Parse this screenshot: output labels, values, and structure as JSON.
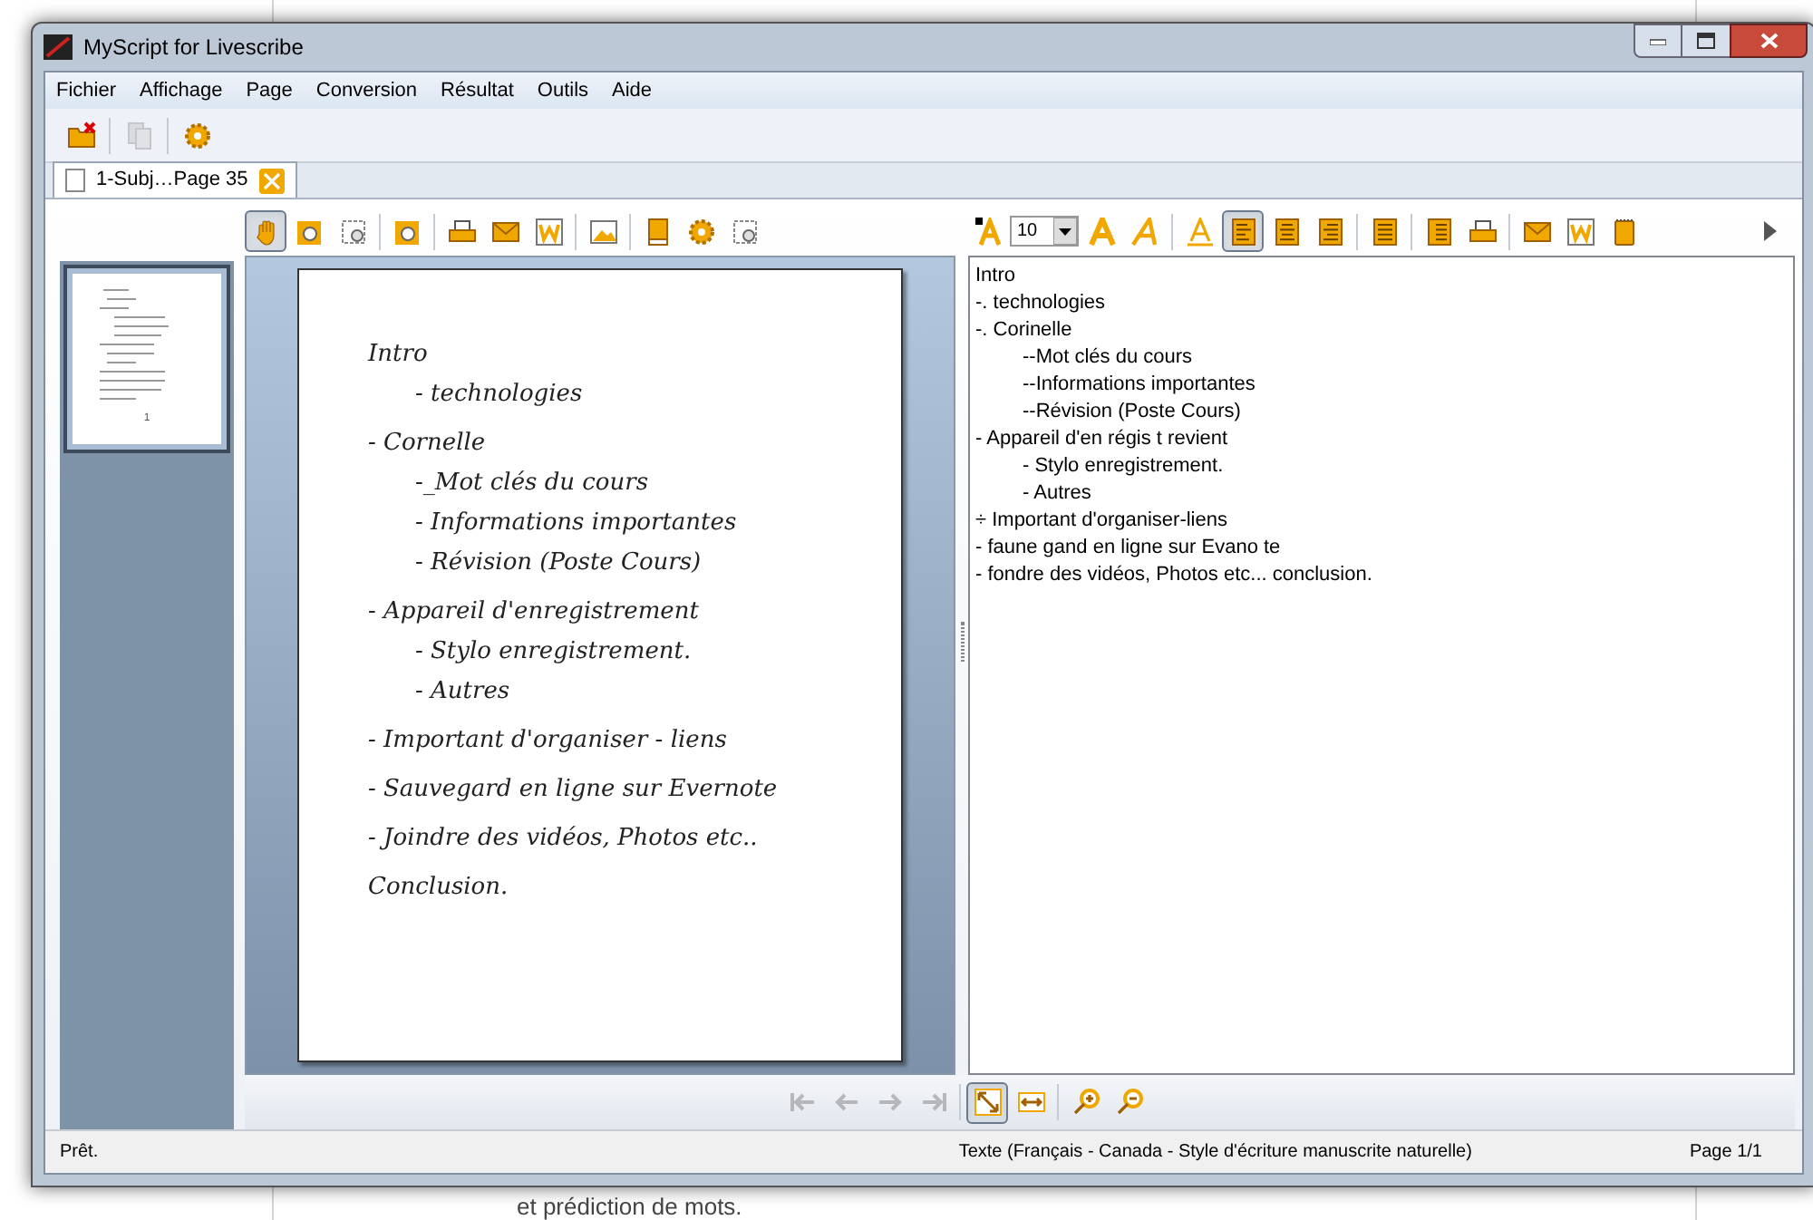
{
  "background": {
    "text": "et prédiction de mots."
  },
  "window": {
    "title": "MyScript for Livescribe"
  },
  "menu": [
    "Fichier",
    "Affichage",
    "Page",
    "Conversion",
    "Résultat",
    "Outils",
    "Aide"
  ],
  "main_toolbar": [
    {
      "disabled": false
    },
    {
      "disabled": true
    },
    {
      "disabled": false
    }
  ],
  "tabs": [
    {
      "label": "1-Subj…Page 35",
      "selected": true
    }
  ],
  "thumbnail": {
    "label": "1",
    "selected": true
  },
  "ink_toolbar": [
    {
      "selected": true
    },
    {
      "selected": false
    },
    {
      "selected": false
    },
    {
      "selected": false
    },
    {
      "selected": false
    },
    {
      "selected": false
    },
    {
      "selected": false
    },
    {
      "selected": false
    },
    {
      "selected": false
    },
    {
      "selected": false
    },
    {
      "selected": false
    }
  ],
  "handwriting": [
    {
      "text": "Intro",
      "children": [
        {
          "text": "- technologies"
        }
      ]
    },
    {
      "text": "- Cornelle",
      "children": [
        {
          "text": "-_Mot clés du cours"
        },
        {
          "text": "- Informations importantes"
        },
        {
          "text": "- Révision (Poste Cours)"
        }
      ]
    },
    {
      "text": "- Appareil d'enregistrement",
      "children": [
        {
          "text": "- Stylo enregistrement."
        },
        {
          "text": "- Autres"
        }
      ]
    },
    {
      "text": "- Important d'organiser - liens"
    },
    {
      "text": "- Sauvegard en ligne sur Evernote"
    },
    {
      "text": "- Joindre des vidéos, Photos etc.."
    },
    {
      "text": "Conclusion."
    }
  ],
  "text_toolbar": {
    "font_size": "10",
    "buttons": [
      {
        "selected": false
      },
      {
        "selected": false
      },
      {
        "selected": false
      },
      {
        "selected": true
      },
      {
        "selected": false
      },
      {
        "selected": false
      },
      {
        "selected": false
      },
      {
        "selected": false
      },
      {
        "selected": false
      },
      {
        "selected": false
      },
      {
        "selected": false
      }
    ]
  },
  "result_text": [
    {
      "text": "Intro"
    },
    {
      "text": "-. technologies"
    },
    {
      "text": "-. Corinelle",
      "children": [
        {
          "text": "--Mot clés du cours"
        },
        {
          "text": "--Informations importantes"
        },
        {
          "text": "--Révision (Poste Cours)"
        }
      ]
    },
    {
      "text": "- Appareil d'en régis t revient",
      "children": [
        {
          "text": "- Stylo enregistrement."
        },
        {
          "text": "- Autres"
        }
      ]
    },
    {
      "text": "÷ Important d'organiser-liens"
    },
    {
      "text": "- faune gand en ligne sur Evano te"
    },
    {
      "text": "- fondre des vidéos, Photos etc... conclusion."
    }
  ],
  "nav_toolbar": [
    {
      "disabled": true,
      "selected": false
    },
    {
      "disabled": true,
      "selected": false
    },
    {
      "disabled": true,
      "selected": false
    },
    {
      "disabled": true,
      "selected": false
    },
    {
      "disabled": false,
      "selected": true
    },
    {
      "disabled": false,
      "selected": false
    },
    {
      "disabled": false,
      "selected": false
    },
    {
      "disabled": false,
      "selected": false
    }
  ],
  "status_bar": {
    "message": "Prêt.",
    "language": "Texte (Français - Canada - Style d'écriture manuscrite naturelle)",
    "page": "Page 1/1"
  }
}
